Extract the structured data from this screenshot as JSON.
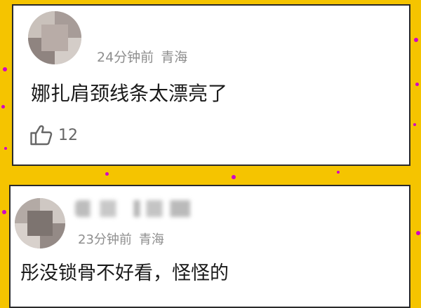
{
  "comments": [
    {
      "time": "24分钟前",
      "location": "青海",
      "text": "娜扎肩颈线条太漂亮了",
      "likes": "12"
    },
    {
      "time": "23分钟前",
      "location": "青海",
      "text": "彤没锁骨不好看，怪怪的"
    }
  ],
  "colors": {
    "frame": "#f5c400",
    "confetti": "#d000c8",
    "card_border": "#2a2a2a",
    "meta_text": "#8e8e8e",
    "comment_text": "#1a1a1a"
  },
  "icons": {
    "like": "thumbs-up-icon"
  }
}
